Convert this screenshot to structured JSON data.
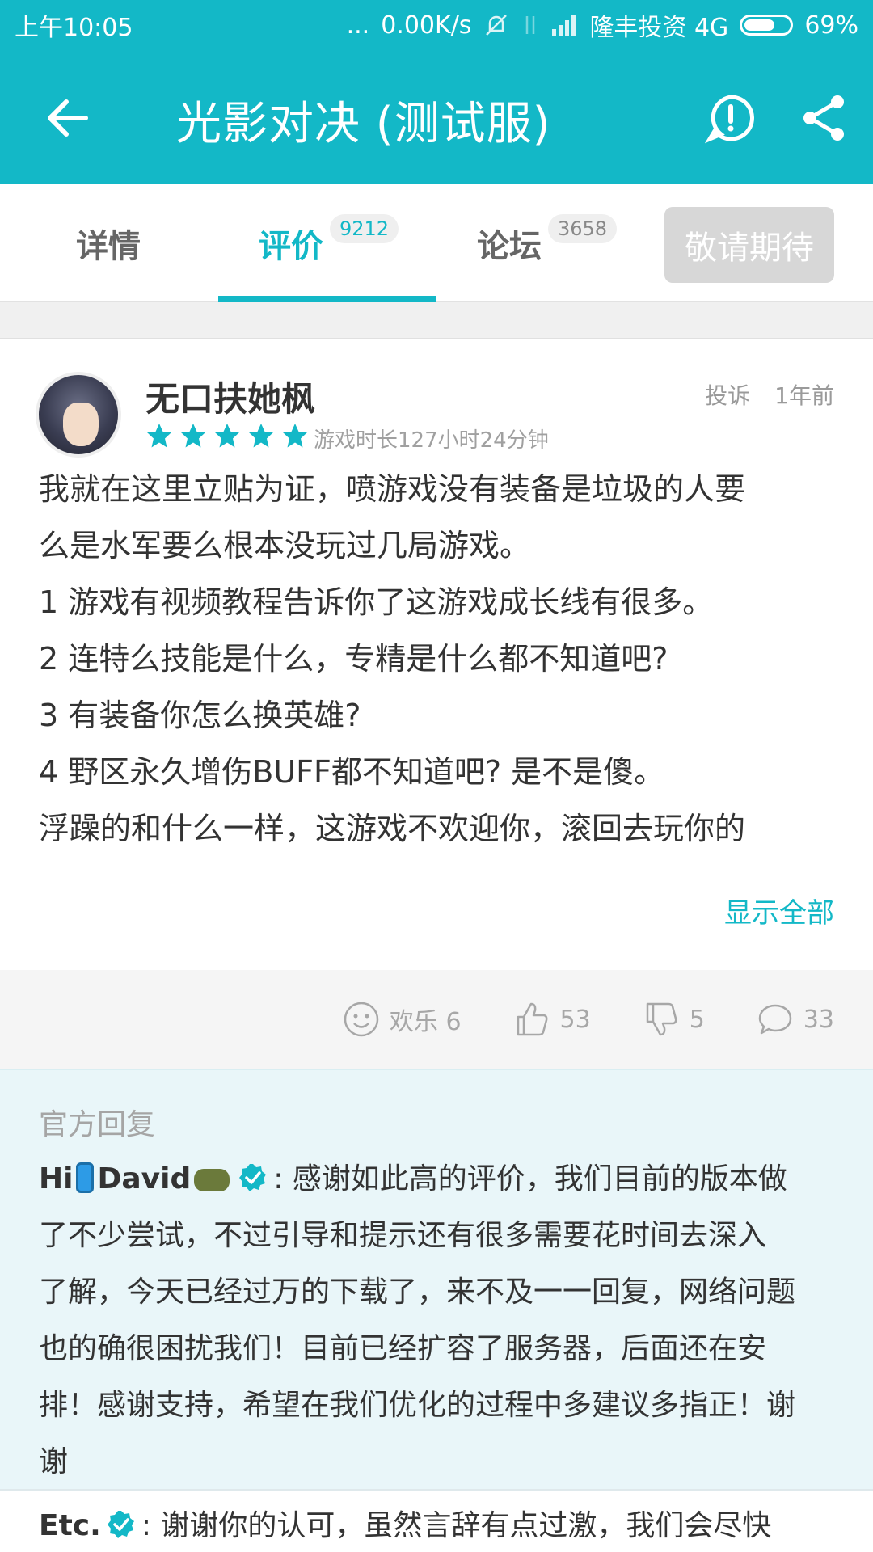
{
  "status_bar": {
    "time": "上午10:05",
    "dots": "...",
    "speed": "0.00K/s",
    "carrier": "隆丰投资 4G",
    "battery": "69%",
    "battery_level": 0.69
  },
  "app_bar": {
    "title": "光影对决 (测试服)"
  },
  "tabs": [
    {
      "label": "详情",
      "badge": ""
    },
    {
      "label": "评价",
      "badge": "9212"
    },
    {
      "label": "论坛",
      "badge": "3658"
    }
  ],
  "expect_button": "敬请期待",
  "review": {
    "username": "无口扶她枫",
    "rating": 5,
    "playtime": "游戏时长127小时24分钟",
    "report_label": "投诉",
    "time_ago": "1年前",
    "lines": [
      "我就在这里立贴为证，喷游戏没有装备是垃圾的人要",
      "么是水军要么根本没玩过几局游戏。",
      "1 游戏有视频教程告诉你了这游戏成长线有很多。",
      "2 连特么技能是什么，专精是什么都不知道吧?",
      "3 有装备你怎么换英雄?",
      "4 野区永久增伤BUFF都不知道吧? 是不是傻。",
      "浮躁的和什么一样，这游戏不欢迎你，滚回去玩你的"
    ],
    "show_all": "显示全部"
  },
  "actions": {
    "fun": "欢乐 6",
    "likes": "53",
    "dislikes": "5",
    "comments": "33"
  },
  "official_reply": {
    "label": "官方回复",
    "replier_hi": "Hi",
    "replier_name": "David",
    "first_line_rest": ": 感谢如此高的评价，我们目前的版本做",
    "lines": [
      "了不少尝试，不过引导和提示还有很多需要花时间去深入",
      "了解，今天已经过万的下载了，来不及一一回复，网络问题",
      "也的确很困扰我们！目前已经扩容了服务器，后面还在安",
      "排！感谢支持，希望在我们优化的过程中多建议多指正！谢",
      "谢"
    ]
  },
  "second_reply": {
    "replier": "Etc.",
    "text": ": 谢谢你的认可，虽然言辞有点过激，我们会尽快"
  },
  "colors": {
    "accent": "#13b8c7",
    "reply_bg": "#e9f6f9"
  }
}
